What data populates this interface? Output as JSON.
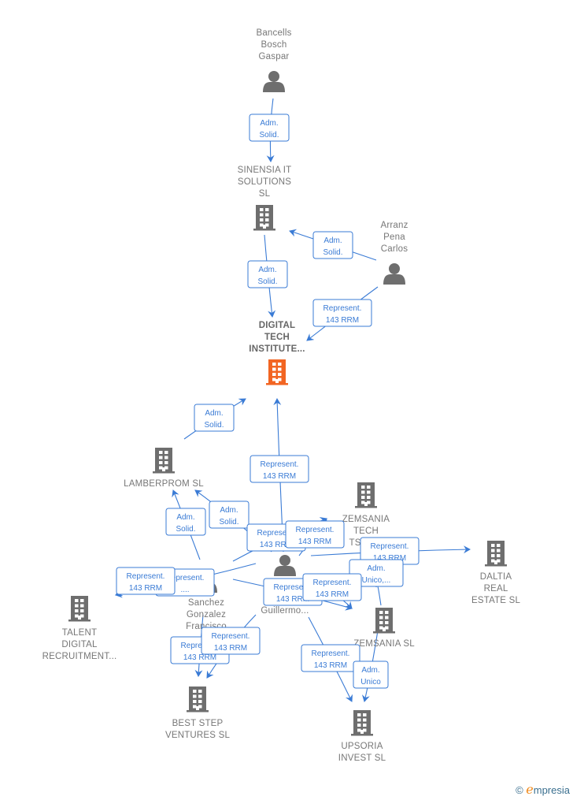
{
  "colors": {
    "edge": "#3a7bd5",
    "node": "#6e6e6e",
    "focus": "#f26522"
  },
  "nodes": [
    {
      "id": "bancells",
      "type": "person",
      "label": [
        "Bancells",
        "Bosch",
        "Gaspar"
      ]
    },
    {
      "id": "sinensia",
      "type": "company",
      "label": [
        "SINENSIA IT",
        "SOLUTIONS",
        "SL"
      ]
    },
    {
      "id": "arranz",
      "type": "person",
      "label": [
        "Arranz",
        "Pena",
        "Carlos"
      ]
    },
    {
      "id": "digital",
      "type": "company-focus",
      "label": [
        "DIGITAL",
        "TECH",
        "INSTITUTE..."
      ]
    },
    {
      "id": "lamberprom",
      "type": "company",
      "label": [
        "LAMBERPROM SL"
      ]
    },
    {
      "id": "zemsania_tech",
      "type": "company",
      "label": [
        "ZEMSANIA",
        "TECH",
        "TSOU..."
      ]
    },
    {
      "id": "daltia",
      "type": "company",
      "label": [
        "DALTIA",
        "REAL",
        "ESTATE  SL"
      ]
    },
    {
      "id": "talent",
      "type": "company",
      "label": [
        "TALENT",
        "DIGITAL",
        "RECRUITMENT..."
      ]
    },
    {
      "id": "sanchez",
      "type": "person",
      "label": [
        "Sanchez",
        "Gonzalez",
        "Francisco"
      ]
    },
    {
      "id": "guillermo",
      "type": "person",
      "label": [
        "Guillermo..."
      ]
    },
    {
      "id": "zemsania",
      "type": "company",
      "label": [
        "ZEMSANIA SL"
      ]
    },
    {
      "id": "beststep",
      "type": "company",
      "label": [
        "BEST STEP",
        "VENTURES  SL"
      ]
    },
    {
      "id": "upsoria",
      "type": "company",
      "label": [
        "UPSORIA",
        "INVEST  SL"
      ]
    }
  ],
  "edges": [
    {
      "from": "bancells",
      "to": "sinensia",
      "label": [
        "Adm.",
        "Solid."
      ]
    },
    {
      "from": "arranz",
      "to": "sinensia",
      "label": [
        "Adm.",
        "Solid."
      ]
    },
    {
      "from": "sinensia",
      "to": "digital",
      "label": [
        "Adm.",
        "Solid."
      ]
    },
    {
      "from": "arranz",
      "to": "digital",
      "label": [
        "Represent.",
        "143 RRM"
      ]
    },
    {
      "from": "lamberprom",
      "to": "digital",
      "label": [
        "Adm.",
        "Solid."
      ]
    },
    {
      "from": "guillermo",
      "to": "digital",
      "label": [
        "Represent.",
        "143 RRM"
      ]
    },
    {
      "from": "sanchez",
      "to": "lamberprom",
      "label": [
        "Adm.",
        "Solid."
      ]
    },
    {
      "from": "guillermo",
      "to": "lamberprom",
      "label": [
        "Adm.",
        "Solid."
      ]
    },
    {
      "from": "sanchez",
      "to": "zemsania_tech",
      "label": [
        "Represent.",
        "143 RRM"
      ]
    },
    {
      "from": "guillermo",
      "to": "zemsania_tech",
      "label": [
        "Represent.",
        "143 RRM"
      ]
    },
    {
      "from": "guillermo",
      "to": "daltia",
      "label": [
        "Represent.",
        "143 RRM"
      ]
    },
    {
      "from": "zemsania",
      "to": "zemsania_tech",
      "label": [
        "Adm.",
        "Unico,..."
      ]
    },
    {
      "from": "guillermo",
      "to": "talent",
      "label": [
        "Represent.",
        "...."
      ]
    },
    {
      "from": "sanchez",
      "to": "talent",
      "label": [
        "Represent.",
        "143 RRM"
      ]
    },
    {
      "from": "guillermo",
      "to": "zemsania",
      "label": [
        "Represent.",
        "143 RRM"
      ]
    },
    {
      "from": "sanchez",
      "to": "zemsania",
      "label": [
        "Represent.",
        "143 RRM"
      ]
    },
    {
      "from": "sanchez",
      "to": "beststep",
      "label": [
        "Represent.",
        "143 RRM"
      ]
    },
    {
      "from": "guillermo",
      "to": "beststep",
      "label": [
        "Represent.",
        "143 RRM"
      ]
    },
    {
      "from": "guillermo",
      "to": "upsoria",
      "label": [
        "Represent.",
        "143 RRM"
      ]
    },
    {
      "from": "zemsania",
      "to": "upsoria",
      "label": [
        "Adm.",
        "Unico"
      ]
    }
  ],
  "footer": {
    "copyright": "©",
    "brand_initial": "e",
    "brand_rest": "mpresia"
  }
}
